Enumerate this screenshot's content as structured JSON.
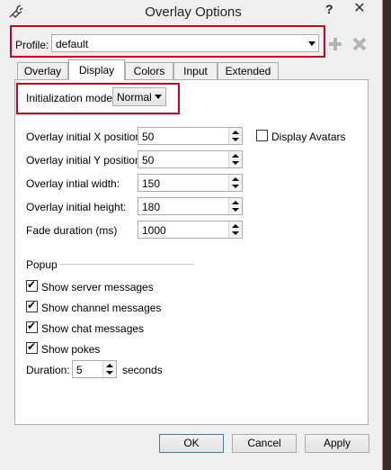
{
  "window": {
    "title": "Overlay Options",
    "help_label": "?",
    "close_label": "✕"
  },
  "profile": {
    "label": "Profile:",
    "value": "default"
  },
  "tabs": [
    {
      "label": "Overlay"
    },
    {
      "label": "Display",
      "active": true
    },
    {
      "label": "Colors"
    },
    {
      "label": "Input"
    },
    {
      "label": "Extended"
    }
  ],
  "display": {
    "init_mode": {
      "label": "Initialization mode:",
      "value": "Normal"
    },
    "x_pos": {
      "label": "Overlay initial X position:",
      "value": "50"
    },
    "y_pos": {
      "label": "Overlay initial Y position:",
      "value": "50"
    },
    "width": {
      "label": "Overlay intial width:",
      "value": "150"
    },
    "height": {
      "label": "Overlay initial height:",
      "value": "180"
    },
    "fade": {
      "label": "Fade duration (ms)",
      "value": "1000"
    },
    "display_avatars": {
      "label": "Display Avatars",
      "checked": false
    }
  },
  "popup": {
    "group_label": "Popup",
    "server": {
      "label": "Show server messages",
      "checked": true
    },
    "channel": {
      "label": "Show channel messages",
      "checked": true
    },
    "chat": {
      "label": "Show chat messages",
      "checked": true
    },
    "pokes": {
      "label": "Show pokes",
      "checked": true
    },
    "duration": {
      "label": "Duration:",
      "value": "5",
      "unit": "seconds"
    }
  },
  "buttons": {
    "ok": "OK",
    "cancel": "Cancel",
    "apply": "Apply"
  },
  "colors": {
    "highlight": "#d0021b",
    "default_button_border": "#3c7fb1"
  }
}
